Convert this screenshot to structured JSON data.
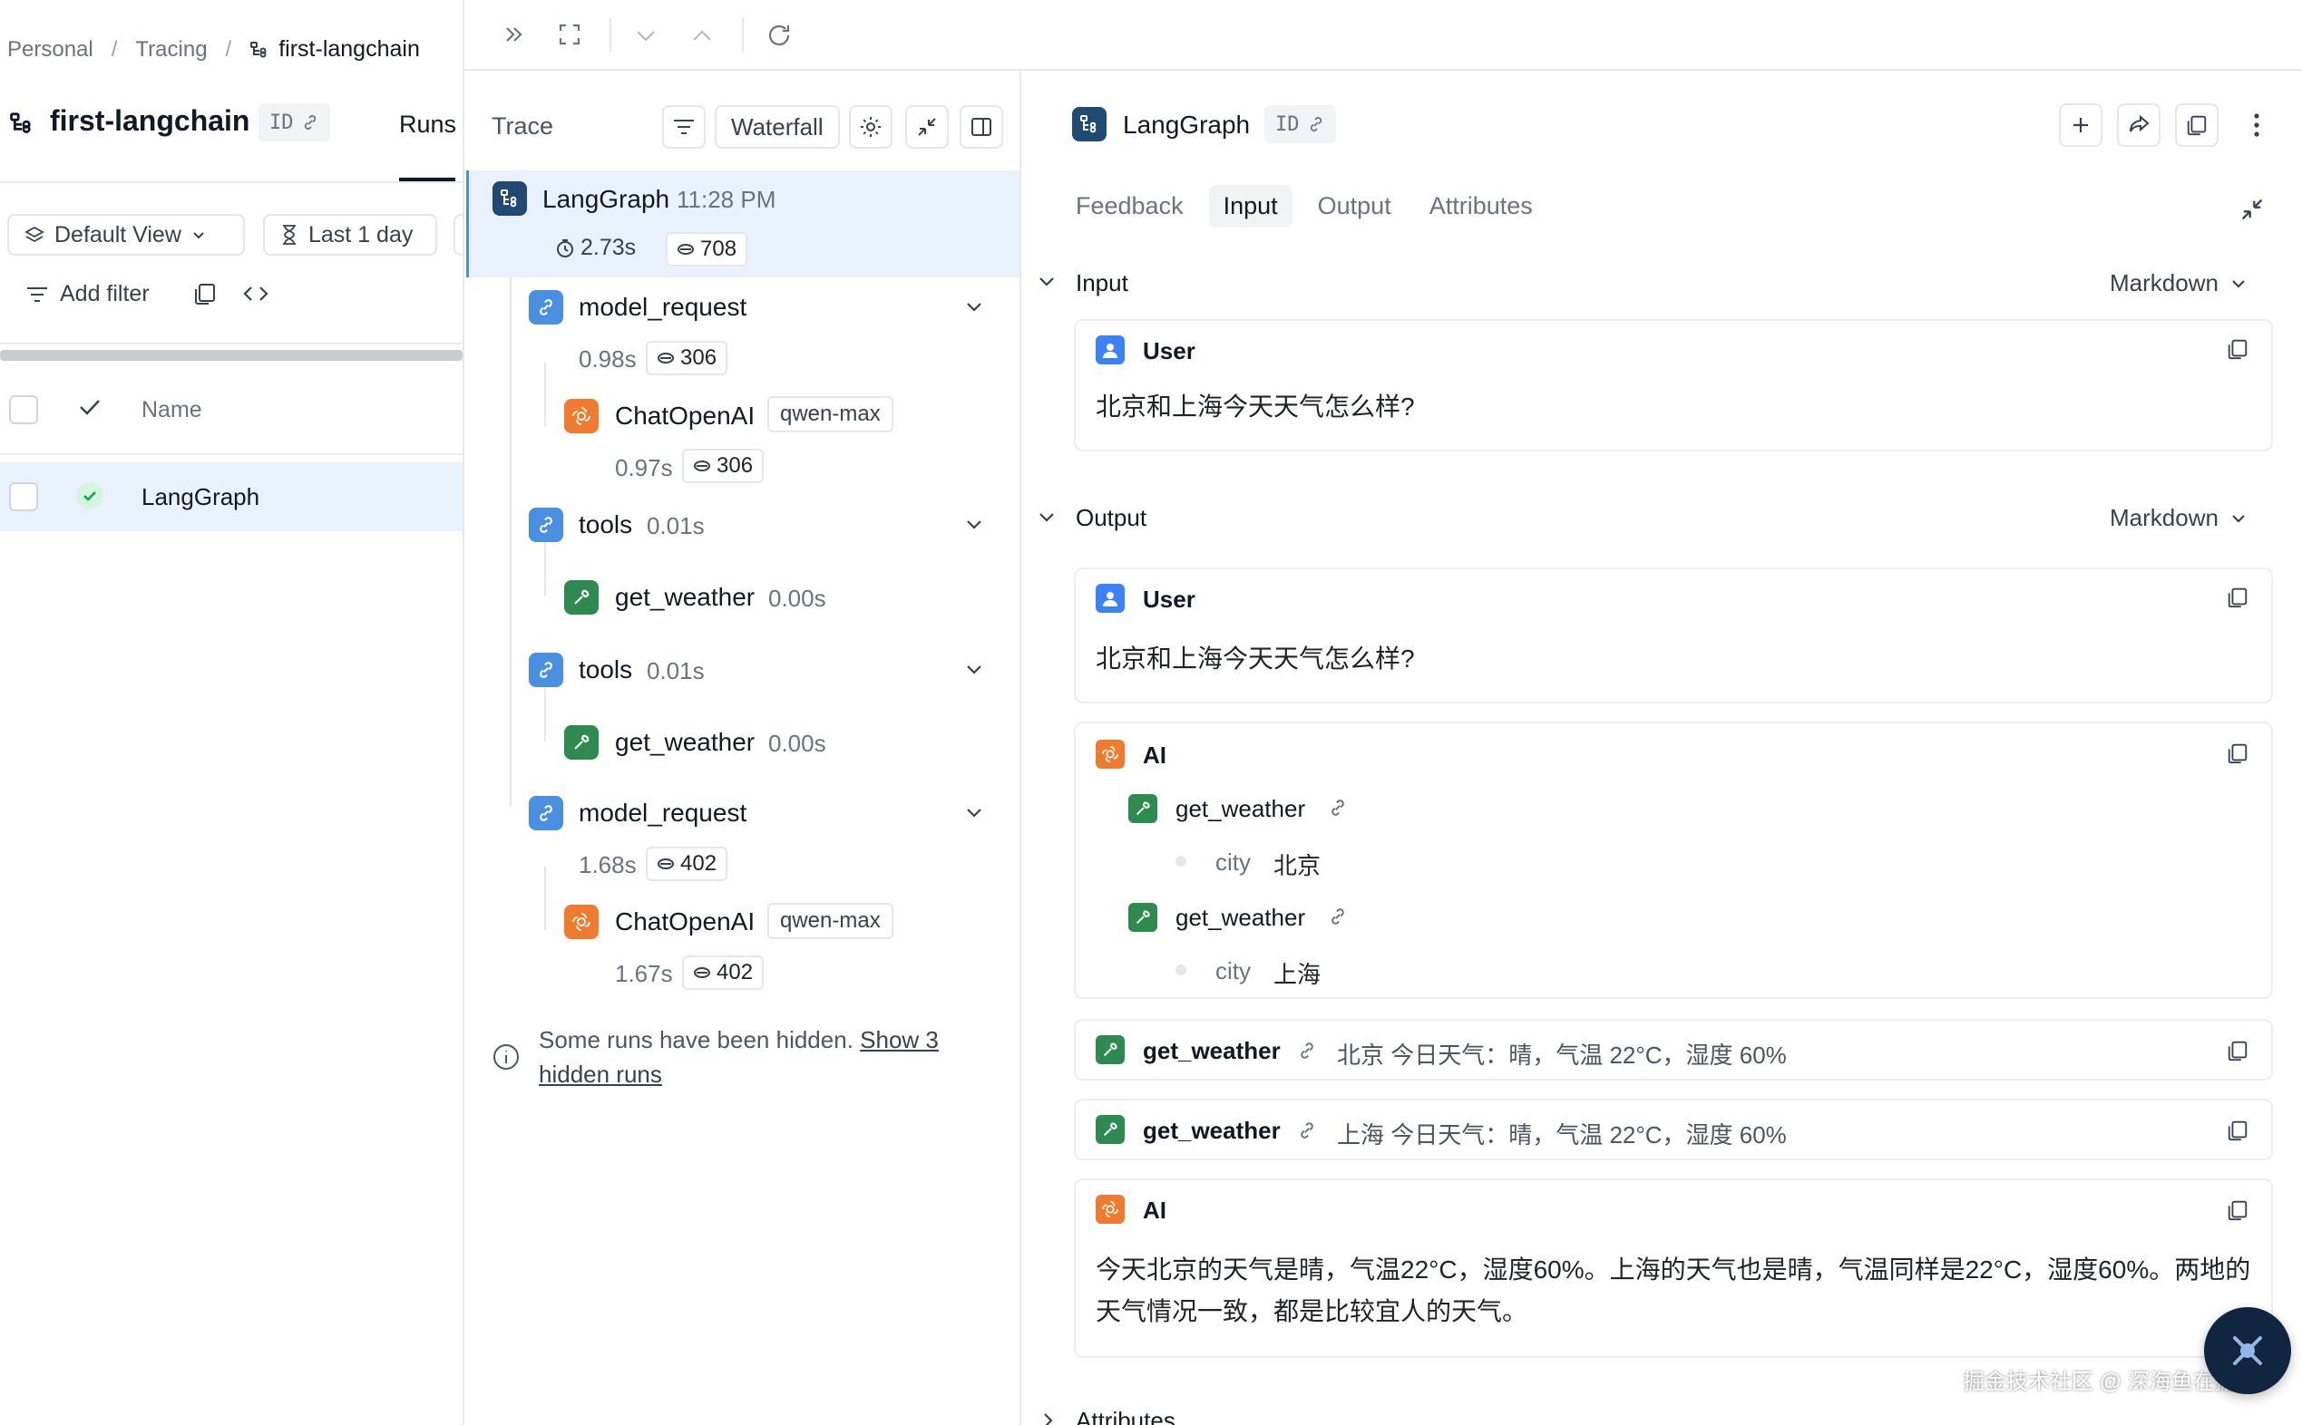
{
  "breadcrumb": {
    "items": [
      "Personal",
      "Tracing"
    ],
    "current": "first-langchain",
    "separator": "/"
  },
  "project": {
    "title": "first-langchain",
    "id_label": "ID",
    "runs_tab": "Runs"
  },
  "runs_toolbar": {
    "view": "Default View",
    "time_range": "Last 1 day",
    "add_filter": "Add filter"
  },
  "runs_table": {
    "name_header": "Name",
    "rows": [
      {
        "name": "LangGraph",
        "status": "success"
      }
    ]
  },
  "trace_panel": {
    "label": "Trace",
    "view_mode": "Waterfall",
    "root": {
      "name": "LangGraph",
      "time": "11:28 PM",
      "latency": "2.73s",
      "tokens": "708"
    },
    "nodes": [
      {
        "name": "model_request",
        "latency": "0.98s",
        "tokens": "306"
      },
      {
        "name": "ChatOpenAI",
        "model": "qwen-max",
        "latency": "0.97s",
        "tokens": "306"
      },
      {
        "name": "tools",
        "latency": "0.01s"
      },
      {
        "name": "get_weather",
        "latency": "0.00s"
      },
      {
        "name": "tools",
        "latency": "0.01s"
      },
      {
        "name": "get_weather",
        "latency": "0.00s"
      },
      {
        "name": "model_request",
        "latency": "1.68s",
        "tokens": "402"
      },
      {
        "name": "ChatOpenAI",
        "model": "qwen-max",
        "latency": "1.67s",
        "tokens": "402"
      }
    ],
    "hidden_note": "Some runs have been hidden.",
    "hidden_link_1": "Show 3",
    "hidden_link_2": "hidden runs"
  },
  "detail": {
    "title": "LangGraph",
    "id_label": "ID",
    "tabs": [
      "Feedback",
      "Input",
      "Output",
      "Attributes"
    ],
    "active_tab": "Input",
    "input_section": {
      "title": "Input",
      "format": "Markdown"
    },
    "output_section": {
      "title": "Output",
      "format": "Markdown"
    },
    "attributes_section": {
      "title": "Attributes"
    },
    "input_message": {
      "role": "User",
      "text": "北京和上海今天天气怎么样?"
    },
    "output_messages": {
      "user": {
        "role": "User",
        "text": "北京和上海今天天气怎么样?"
      },
      "ai_call": {
        "role": "AI",
        "tool_calls": [
          {
            "name": "get_weather",
            "arg_key": "city",
            "arg_value": "北京"
          },
          {
            "name": "get_weather",
            "arg_key": "city",
            "arg_value": "上海"
          }
        ]
      },
      "tool_results": [
        {
          "name": "get_weather",
          "result": "北京 今日天气：晴，气温 22°C，湿度 60%"
        },
        {
          "name": "get_weather",
          "result": "上海 今日天气：晴，气温 22°C，湿度 60%"
        }
      ],
      "ai_final": {
        "role": "AI",
        "line1": "今天北京的天气是晴，气温22°C，湿度60%。上海的天气也是晴，气温同样是22°C，湿度60%。两地的",
        "line2": "天气情况一致，都是比较宜人的天气。"
      }
    }
  },
  "watermark": "掘金技术社区 @ 深海鱼在掘金",
  "colors": {
    "accent": "#4a90e2",
    "selected_row": "#e8f1fc",
    "llm_icon": "#f07b2e",
    "tool_icon": "#2f8a4f",
    "user_icon": "#3b82f6",
    "graph_icon": "#1e4a73"
  }
}
